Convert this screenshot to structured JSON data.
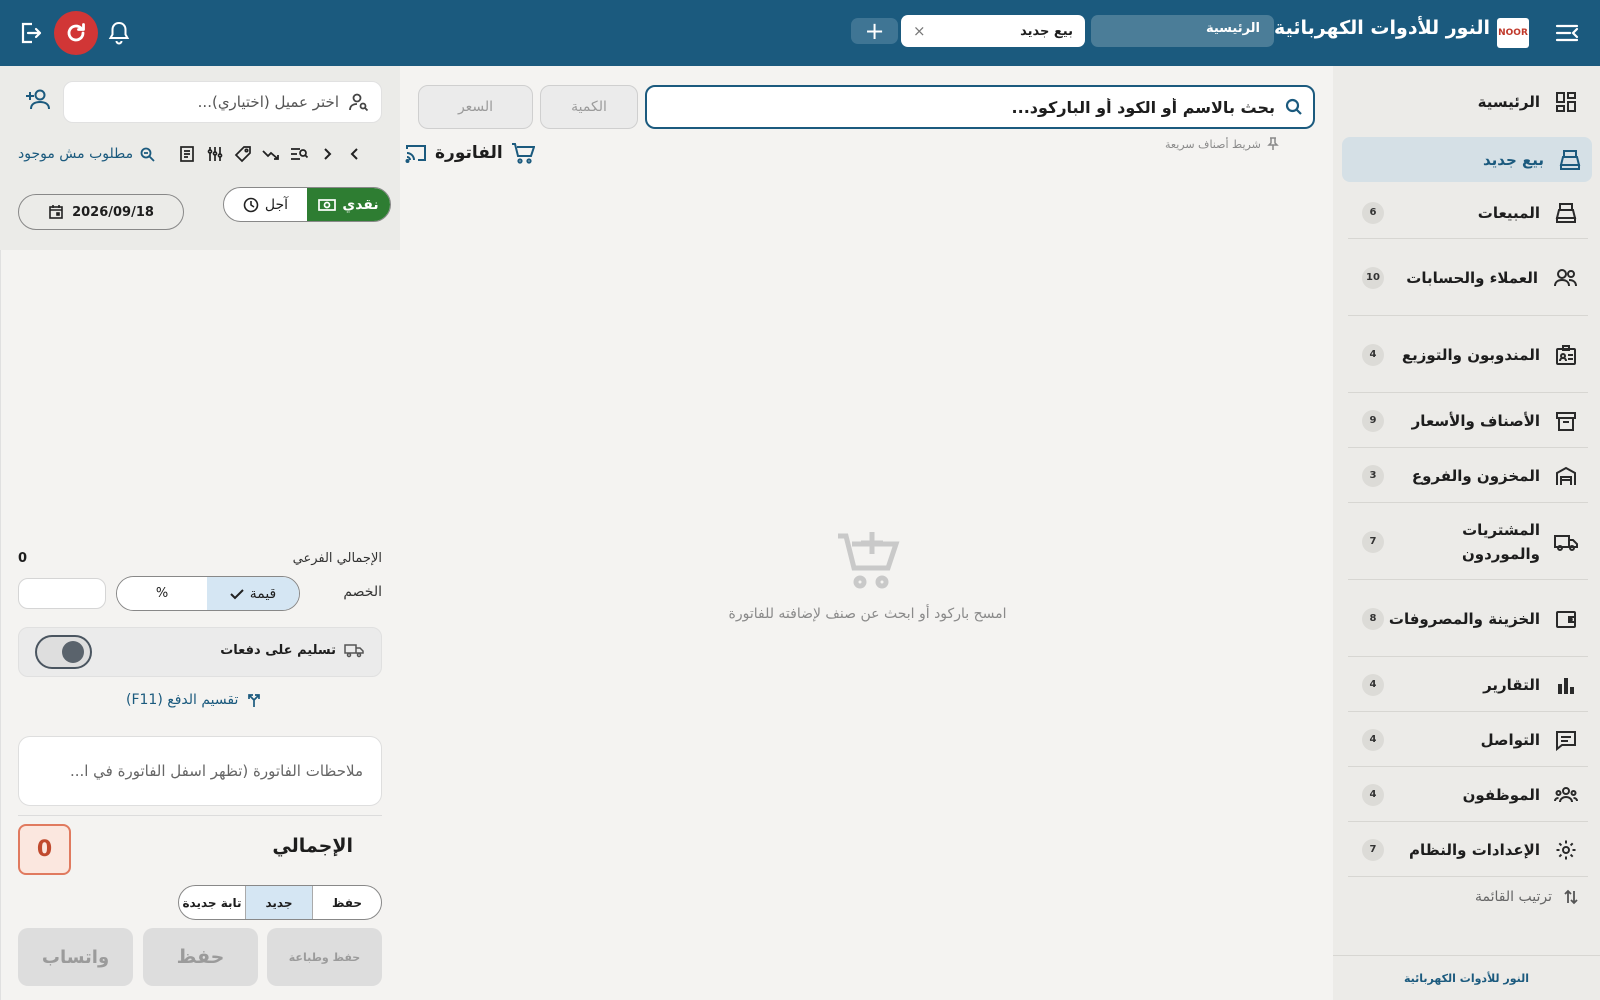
{
  "header": {
    "app_title": "النور للأدوات الكهربائية",
    "logo_text": "NOOR",
    "tabs": [
      {
        "label": "الرئيسية"
      },
      {
        "label": "بيع جديد"
      }
    ],
    "close_symbol": "×",
    "add_symbol": "+",
    "bg_color": "#1b5a7e"
  },
  "sidebar": {
    "items": [
      {
        "label": "الرئيسية",
        "icon": "dashboard-icon"
      },
      {
        "label": "بيع جديد",
        "icon": "register-icon",
        "active": true
      },
      {
        "label": "المبيعات",
        "icon": "register-icon",
        "count": "6"
      },
      {
        "label": "العملاء والحسابات",
        "icon": "people-icon",
        "count": "10"
      },
      {
        "label": "المندوبون والتوزيع",
        "icon": "badge-icon",
        "count": "4"
      },
      {
        "label": "الأصناف والأسعار",
        "icon": "archive-icon",
        "count": "9"
      },
      {
        "label": "المخزون والفروع",
        "icon": "warehouse-icon",
        "count": "3"
      },
      {
        "label": "المشتريات والموردون",
        "icon": "truck-icon",
        "count": "7"
      },
      {
        "label": "الخزينة والمصروفات",
        "icon": "wallet-icon",
        "count": "8"
      },
      {
        "label": "التقارير",
        "icon": "bar-chart-icon",
        "count": "4"
      },
      {
        "label": "التواصل",
        "icon": "chat-icon",
        "count": "4"
      },
      {
        "label": "الموظفون",
        "icon": "group-icon",
        "count": "4"
      },
      {
        "label": "الإعدادات والنظام",
        "icon": "gear-icon",
        "count": "7"
      }
    ],
    "sort_label": "ترتيب القائمة",
    "footer": "النور للأدوات الكهربائية"
  },
  "center": {
    "search_placeholder": "بحث بالاسم أو الكود أو الباركود...",
    "qty_placeholder": "الكمية",
    "price_placeholder": "السعر",
    "quick_bar_label": "شريط أصناف سريعة",
    "invoice_title": "الفاتورة",
    "empty_message": "امسح باركود أو ابحث عن صنف لإضافته للفاتورة"
  },
  "left_panel": {
    "customer_placeholder": "اختر عميل (اختياري)...",
    "not_found_link": "مطلوب مش موجود",
    "pay_cash": "نقدي",
    "pay_credit": "آجل",
    "date": "2026/09/18",
    "subtotal_label": "الإجمالي الفرعي",
    "subtotal_value": "0",
    "discount_label": "الخصم",
    "discount_value_option": "قيمة",
    "discount_percent_option": "%",
    "delivery_label": "تسليم على دفعات",
    "split_payment": "تقسيم الدفع (F11)",
    "notes_placeholder": "ملاحظات الفاتورة (تظهر اسفل الفاتورة في ا...",
    "total_label": "الإجمالي",
    "total_value": "0",
    "save_modes": {
      "save": "حفظ",
      "new": "جديد",
      "new_tab": "تابة جديدة"
    },
    "btn_save_print": "حفظ وطباعة",
    "btn_save": "حفظ",
    "btn_whatsapp": "واتساب"
  }
}
